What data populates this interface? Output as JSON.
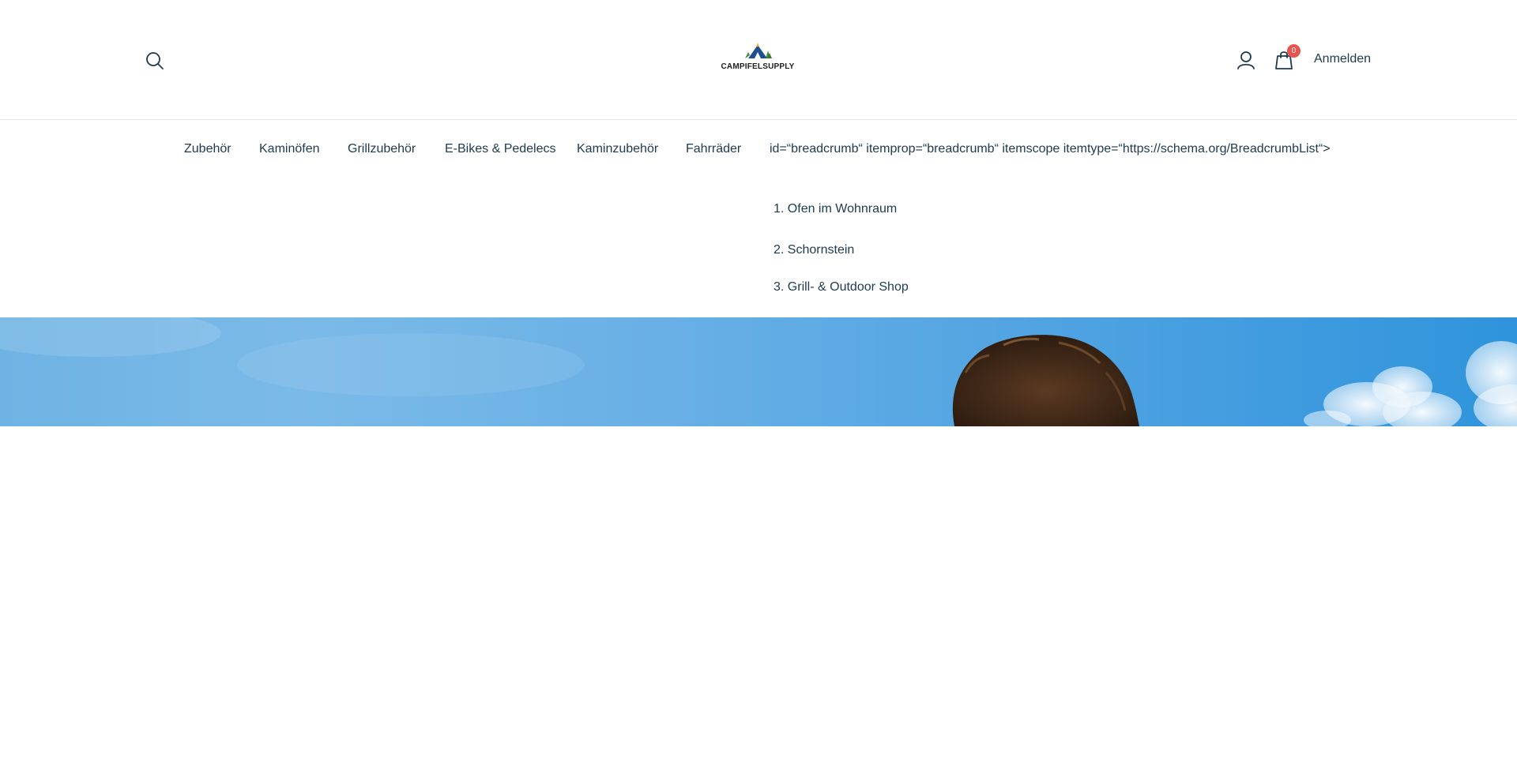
{
  "header": {
    "logo_text": "CAMPIFELSUPPLY",
    "cart_count": "0",
    "login_label": "Anmelden"
  },
  "nav": {
    "items": [
      {
        "label": "Zubehör"
      },
      {
        "label": "Kaminöfen"
      },
      {
        "label": "Grillzubehör"
      },
      {
        "label": "E-Bikes & Pedelecs"
      },
      {
        "label": "Kaminzubehör"
      },
      {
        "label": "Fahrräder"
      }
    ],
    "breadcrumb_raw": "id=“breadcrumb“ itemprop=“breadcrumb“ itemscope itemtype=“https://schema.org/BreadcrumbList“>",
    "breadcrumb": [
      {
        "num": "1.",
        "label": "Ofen im Wohnraum"
      },
      {
        "num": "2.",
        "label": "Schornstein"
      },
      {
        "num": "3.",
        "label": "Grill- & Outdoor Shop"
      }
    ]
  },
  "colors": {
    "text": "#1f3a4d",
    "badge": "#e8554e",
    "sky": "#5aa9e2"
  },
  "icons": [
    "search-icon",
    "user-icon",
    "shopping-bag-icon",
    "tent-logo-icon"
  ]
}
